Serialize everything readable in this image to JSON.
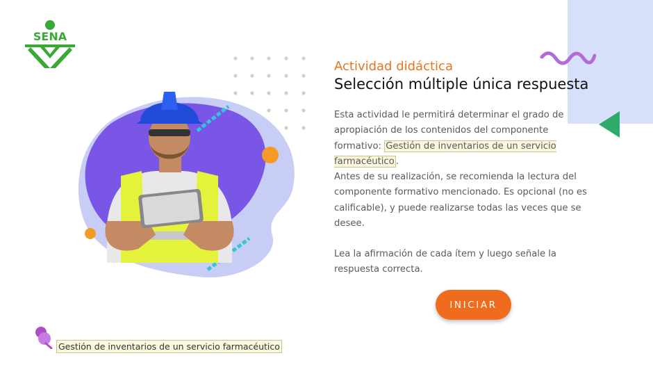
{
  "logo": {
    "text": "SENA",
    "color": "#39a935"
  },
  "header": {
    "subtitle": "Actividad didáctica",
    "title": "Selección múltiple única respuesta"
  },
  "content": {
    "p1_text": "Esta actividad le permitirá determinar el grado de apropiación de los contenidos del componente formativo:",
    "p1_link": "Gestión de inventarios de un servicio farmacéutico",
    "p1_end": ".",
    "p2": "Antes de su realización, se recomienda la lectura del componente formativo mencionado.  Es opcional (no es calificable), y puede realizarse todas las veces que se desee.",
    "p3": "Lea la afirmación de cada ítem y luego señale la respuesta correcta."
  },
  "actions": {
    "start_label": "INICIAR"
  },
  "footer": {
    "link_text": "Gestión de inventarios de un servicio farmacéutico"
  },
  "colors": {
    "accent": "#ef6b1d",
    "orange_title": "#e8751d",
    "light_blue": "#d6e0fb",
    "green": "#2faa6a",
    "purple": "#b36bd6"
  },
  "icons": [
    "sena-logo-icon",
    "wave-decoration-icon",
    "triangle-decoration-icon",
    "pin-icon"
  ]
}
